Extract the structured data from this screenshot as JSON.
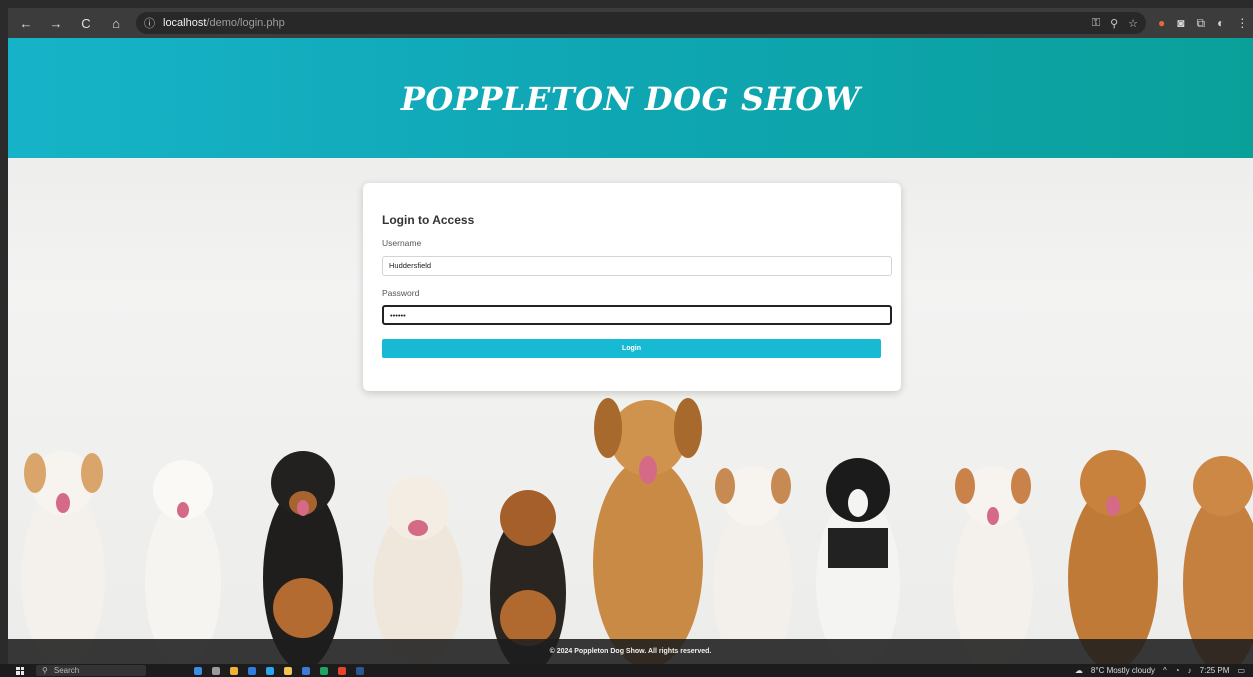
{
  "browser": {
    "url_host": "localhost",
    "url_path": "/demo/login.php",
    "nav": {
      "back": "←",
      "forward": "→",
      "reload": "C",
      "home": "⌂"
    }
  },
  "header": {
    "title": "POPPLETON DOG SHOW"
  },
  "login": {
    "heading": "Login to Access",
    "username_label": "Username",
    "username_value": "Huddersfield",
    "password_label": "Password",
    "password_value": "••••••",
    "button_label": "Login"
  },
  "footer": {
    "text": "© 2024 Poppleton Dog Show. All rights reserved."
  },
  "taskbar": {
    "search_placeholder": "Search",
    "weather": "8°C Mostly cloudy",
    "time": "7:25 PM"
  },
  "colors": {
    "header_start": "#16b3c8",
    "header_end": "#0aa09a",
    "button": "#18b9d3"
  }
}
